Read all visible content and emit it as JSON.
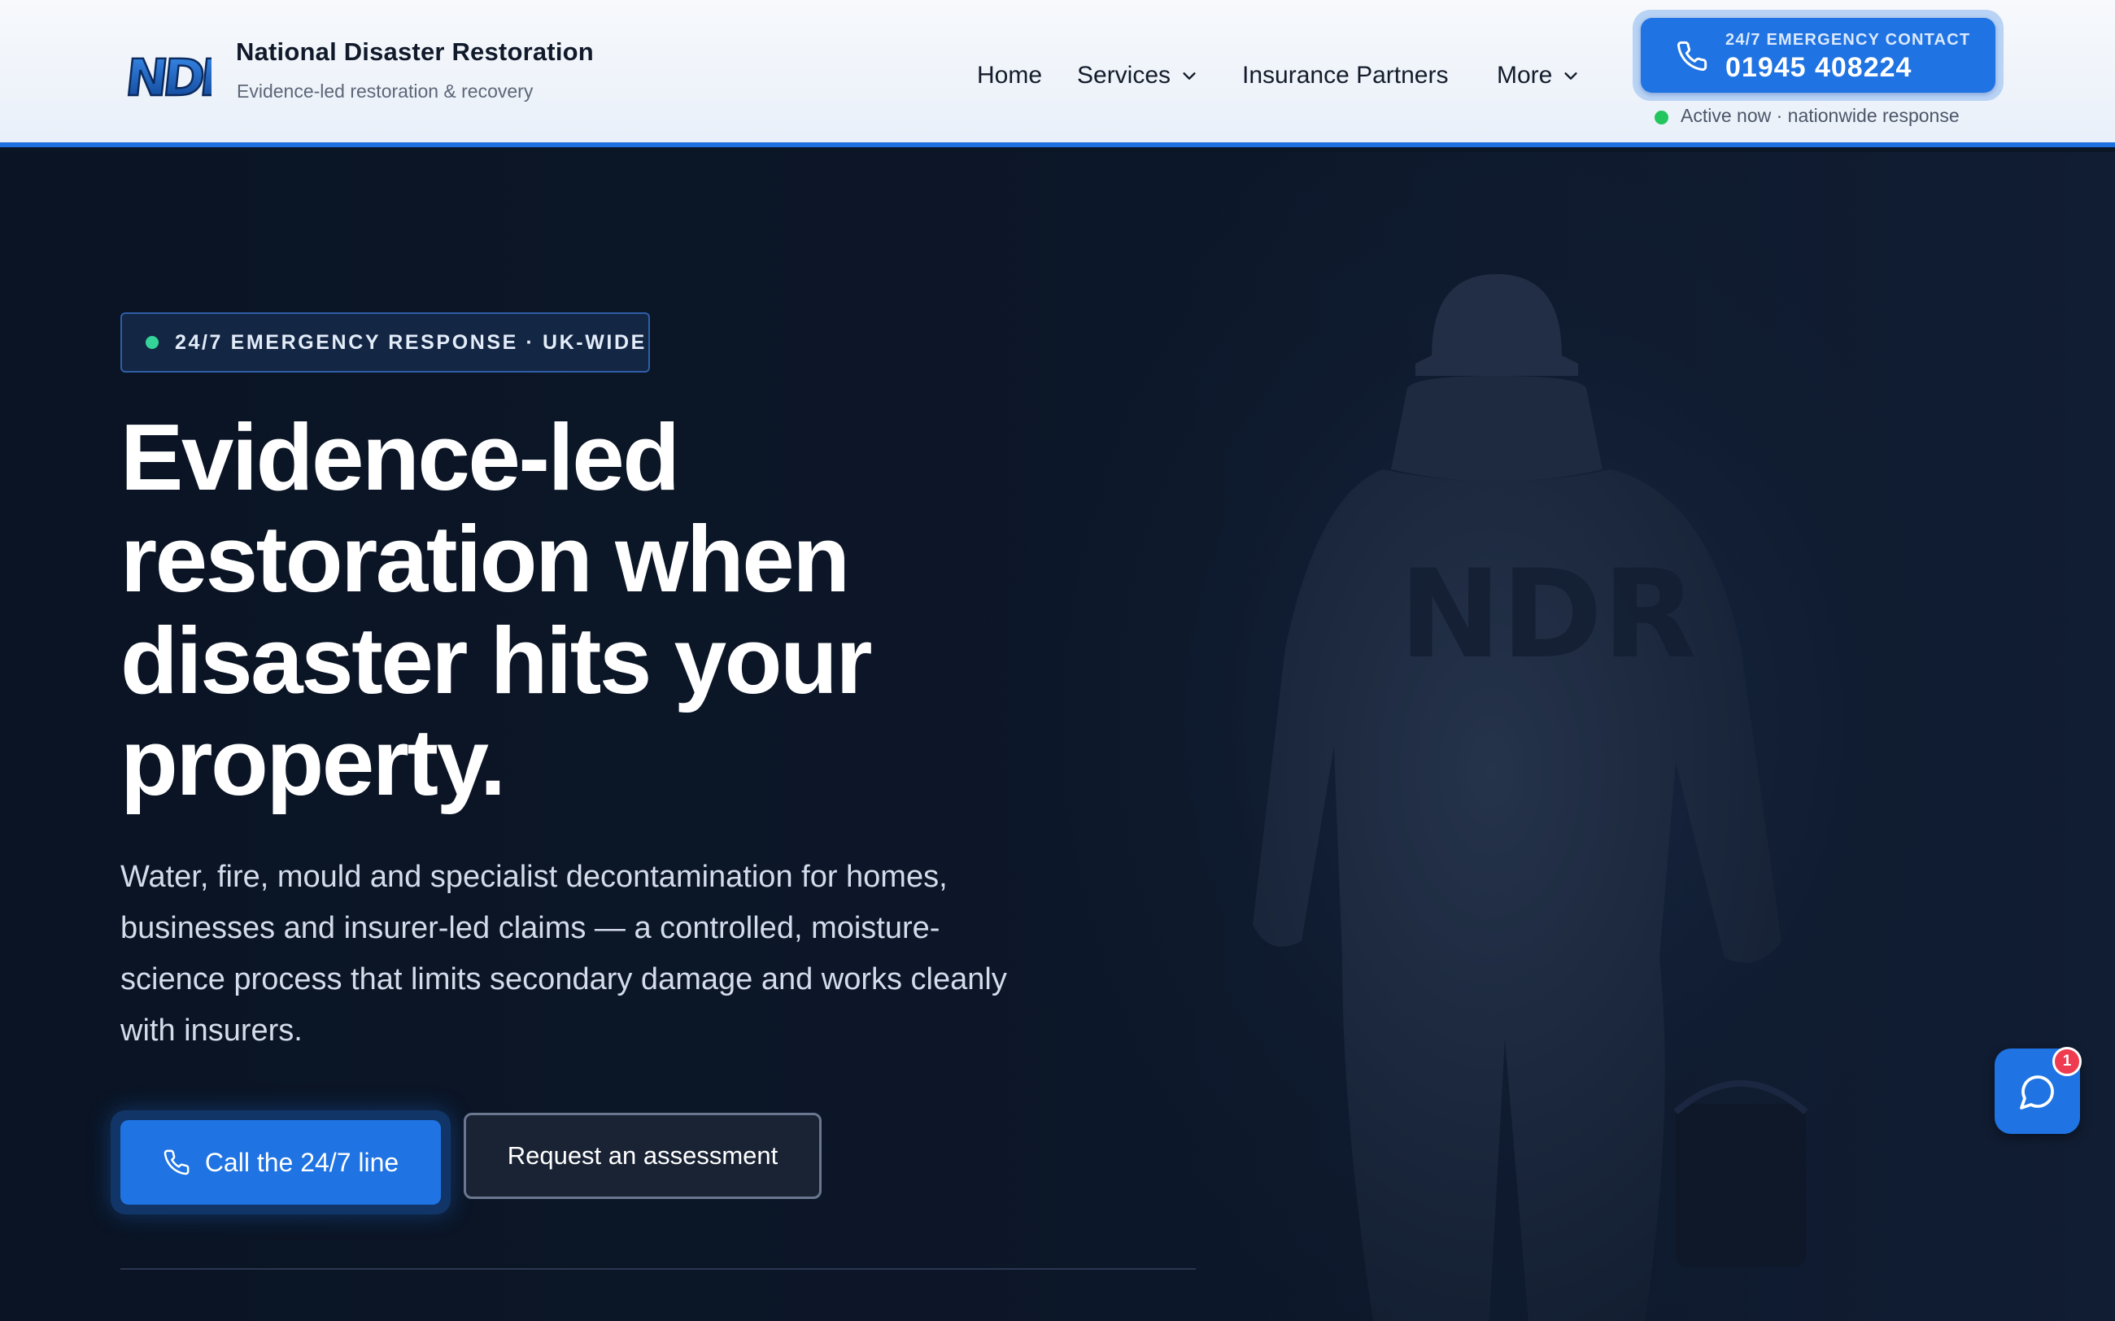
{
  "brand": {
    "logo_text": "NDR",
    "name": "National Disaster Restoration",
    "tagline": "Evidence-led restoration & recovery"
  },
  "nav": {
    "items": [
      {
        "label": "Home",
        "icon": null
      },
      {
        "label": "Services",
        "icon": "chevron-down-icon"
      },
      {
        "label": "Insurance Partners",
        "icon": null
      },
      {
        "label": "More",
        "icon": "chevron-down-icon"
      }
    ]
  },
  "emergency": {
    "icon": "phone-icon",
    "label": "24/7 EMERGENCY CONTACT",
    "number": "01945 408224",
    "status": "Active now · nationwide response"
  },
  "hero": {
    "badge": "24/7 EMERGENCY RESPONSE · UK-WIDE",
    "title_lines": [
      "Evidence-led",
      "restoration when",
      "disaster hits your",
      "property."
    ],
    "description": "Water, fire, mould and specialist decontamination for homes, businesses and insurer-led claims — a controlled, moisture-science process that limits secondary damage and works cleanly with insurers.",
    "primary_cta": "Call the 24/7 line",
    "secondary_cta": "Request an assessment",
    "background_mark": "NDR"
  },
  "chat": {
    "icon": "chat-bubble-icon",
    "unread_count": "1"
  },
  "colors": {
    "accent": "#1f73e2",
    "hero_bg": "#0b1627",
    "status_green": "#22c55e",
    "badge_dot": "#34d399",
    "notification_red": "#ef3b4f"
  }
}
